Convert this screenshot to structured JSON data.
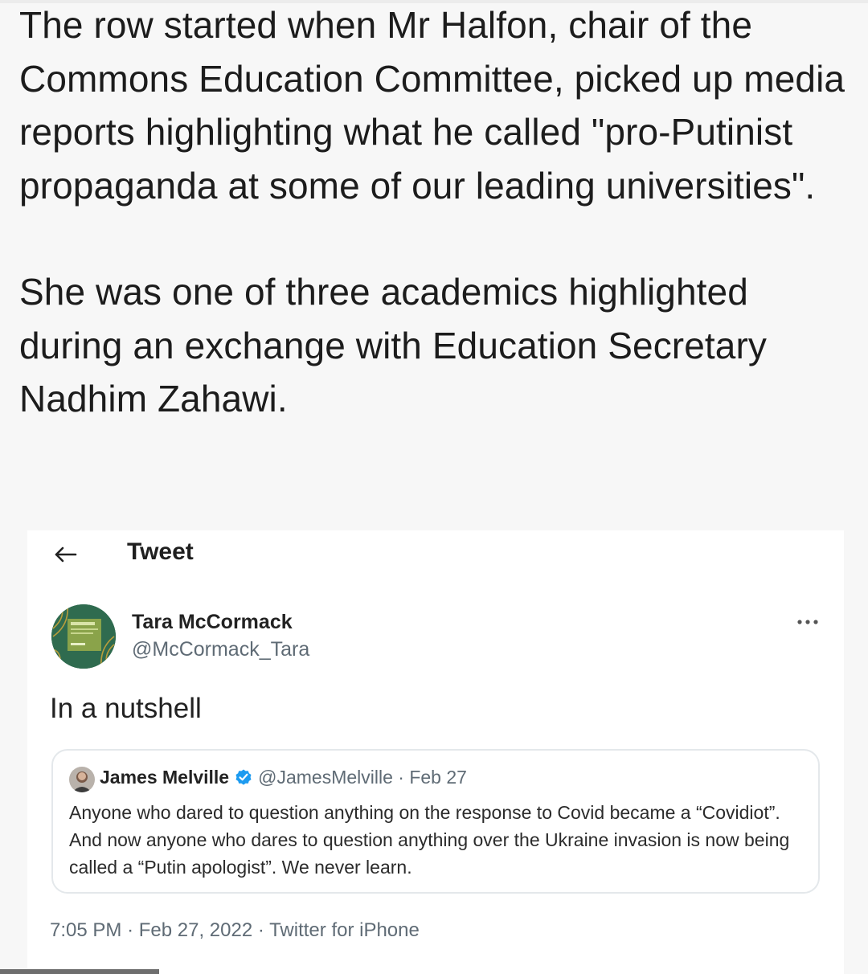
{
  "article": {
    "paragraphs": [
      "The row started when Mr Halfon, chair of the Commons Education Committee, picked up media reports highlighting what he called \"pro-Putinist propaganda at some of our leading universities\".",
      "She was one of three academics highlighted during an exchange with Education Secretary Nadhim Zahawi."
    ]
  },
  "tweet": {
    "header_title": "Tweet",
    "back_icon": "arrow-left-icon",
    "more_icon": "more-horizontal-icon",
    "author": {
      "name": "Tara McCormack",
      "handle": "@McCormack_Tara"
    },
    "text": "In a nutshell",
    "quote": {
      "name": "James Melville",
      "verified": true,
      "handle": "@JamesMelville",
      "separator": "·",
      "date": "Feb 27",
      "text": "Anyone who dared to question anything on the response to Covid became a “Covidiot”. And now anyone who dares to question anything over the Ukraine invasion is now being called a “Putin apologist”. We never learn."
    },
    "footer": {
      "time": "7:05 PM",
      "separator": "·",
      "date": "Feb 27, 2022",
      "source": "Twitter for iPhone"
    }
  },
  "colors": {
    "page_background": "#f7f7f7",
    "verified_badge": "#1d9bf0",
    "secondary_text": "#5f6b75"
  }
}
